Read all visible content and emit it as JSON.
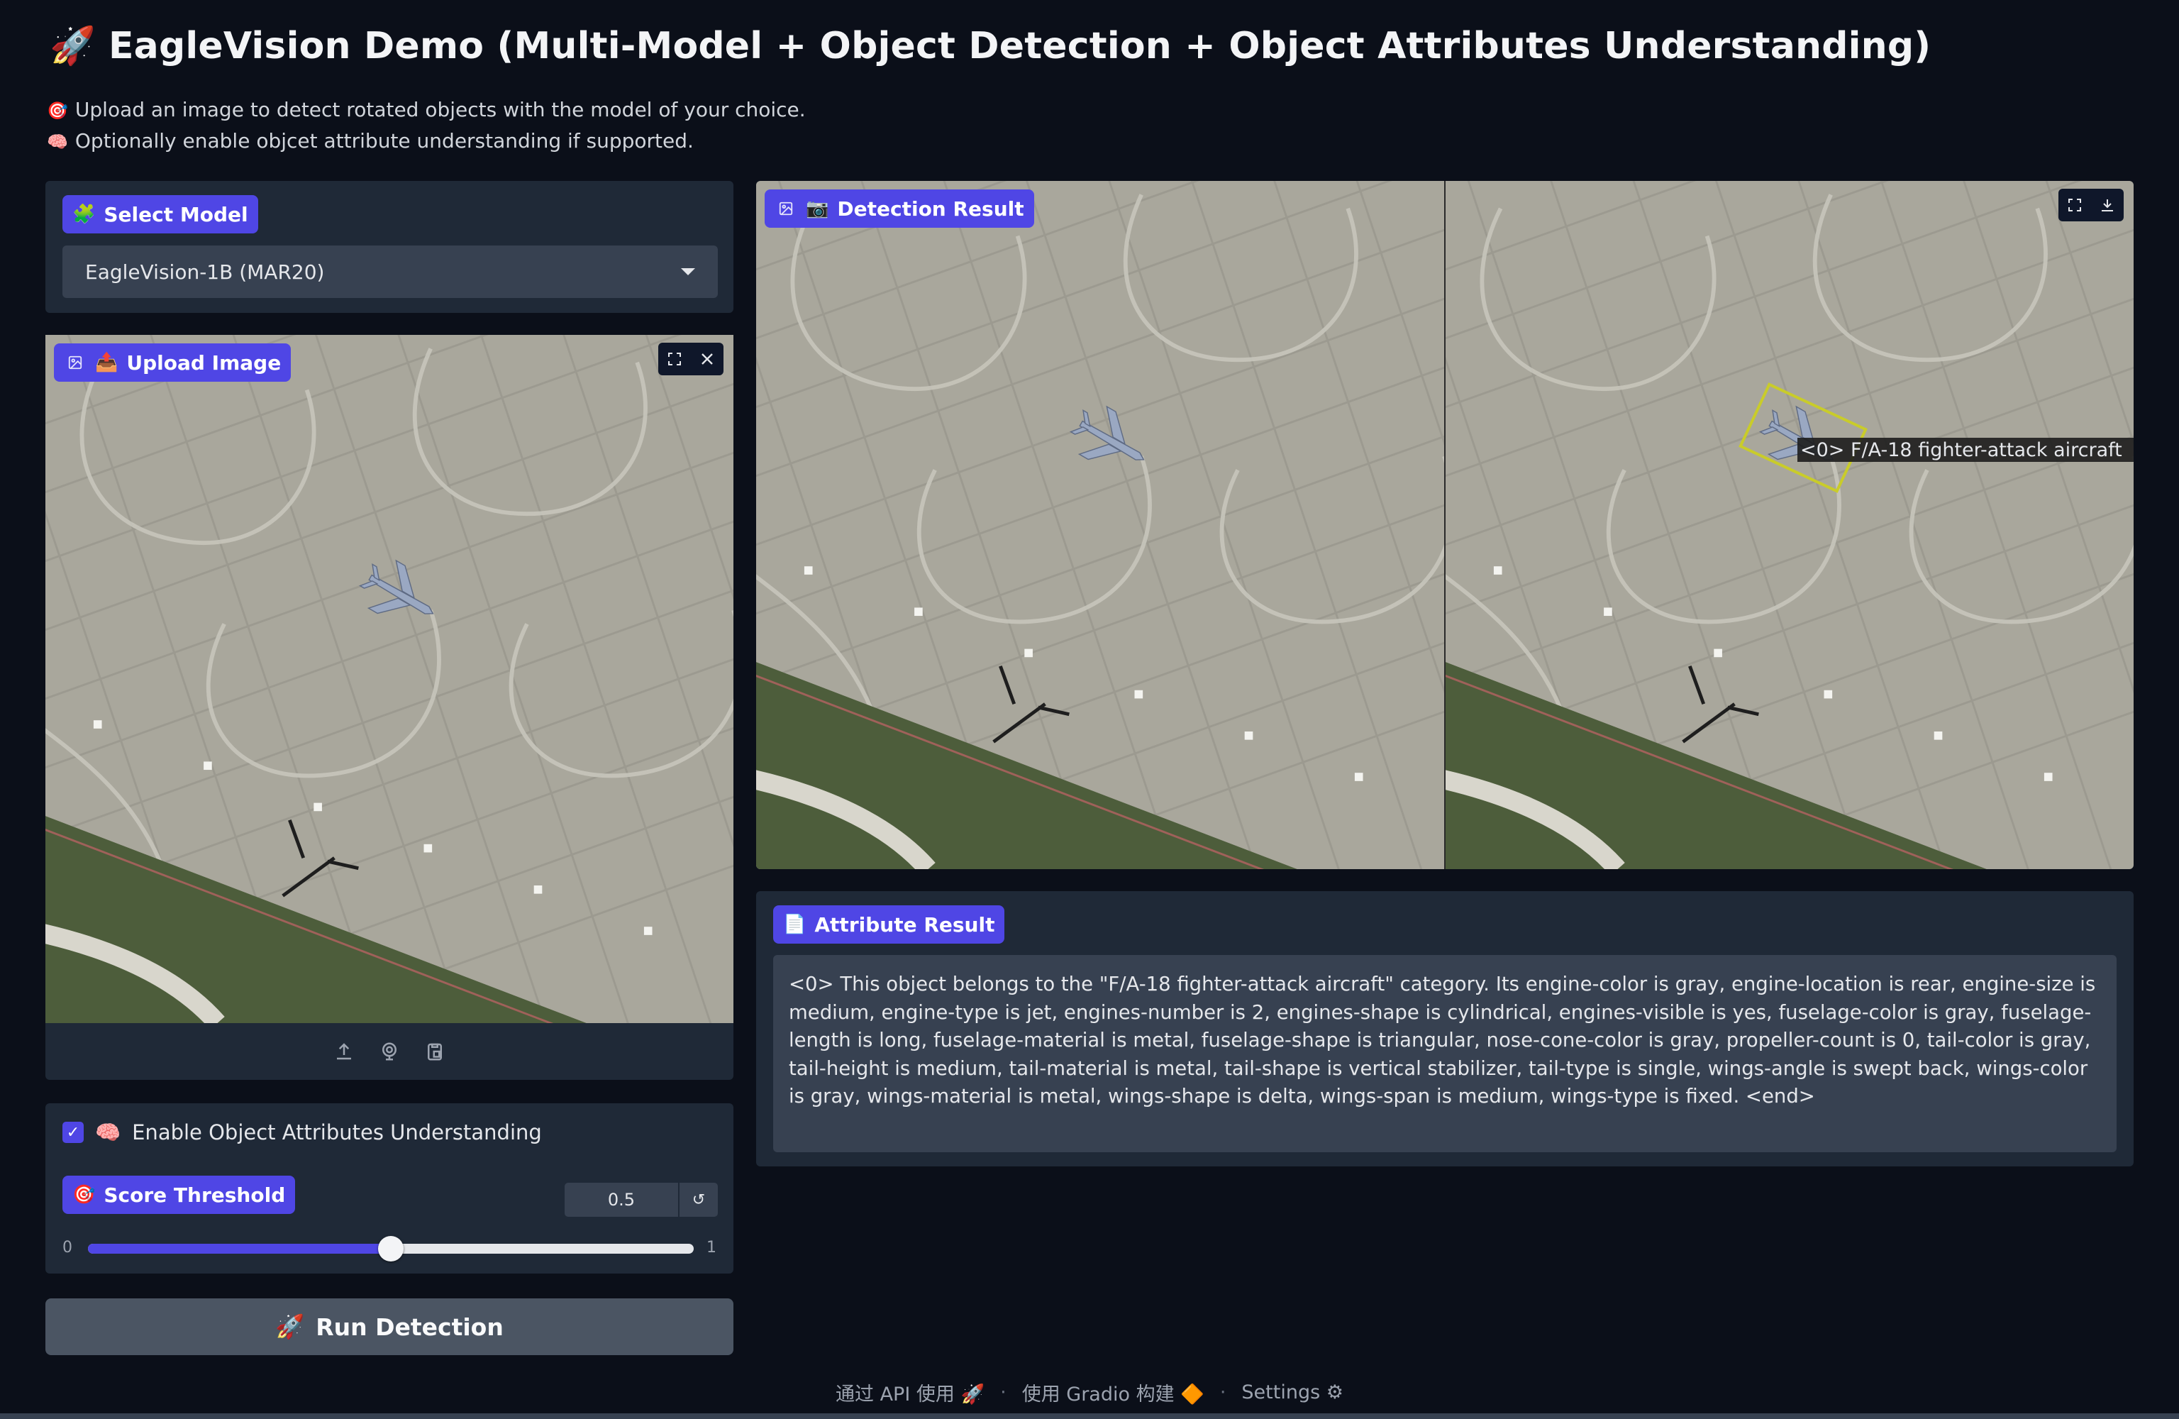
{
  "header": {
    "title": "EagleVision Demo (Multi-Model + Object Detection + Object Attributes Understanding)",
    "title_icon": "rocket-icon",
    "desc_lines": [
      {
        "icon": "target-icon",
        "emoji": "🎯",
        "text": "Upload an image to detect rotated objects with the model of your choice."
      },
      {
        "icon": "brain-icon",
        "emoji": "🧠",
        "text": "Optionally enable objcet attribute understanding if supported."
      }
    ]
  },
  "model": {
    "label": "Select Model",
    "label_emoji": "🧩",
    "selected": "EagleVision-1B (MAR20)"
  },
  "upload": {
    "label": "Upload Image",
    "label_emoji": "📤"
  },
  "options": {
    "attr_label": "Enable Object Attributes Understanding",
    "attr_emoji": "🧠",
    "attr_checked": true,
    "threshold_label": "Score Threshold",
    "threshold_emoji": "🎯",
    "threshold_value": "0.5",
    "slider_min": "0",
    "slider_max": "1",
    "slider_fraction": 0.5
  },
  "run_button": {
    "label": "Run Detection",
    "emoji": "🚀"
  },
  "detection": {
    "label": "Detection Result",
    "label_emoji": "📷",
    "box_label": "<0> F/A-18 fighter-attack aircraft"
  },
  "attributes": {
    "label": "Attribute Result",
    "label_emoji": "📄",
    "text": "<0> This object belongs to the \"F/A-18 fighter-attack aircraft\" category. Its engine-color is gray, engine-location is rear, engine-size is medium, engine-type is jet, engines-number is 2, engines-shape is cylindrical, engines-visible is yes, fuselage-color is gray, fuselage-length is long, fuselage-material is metal, fuselage-shape is triangular, nose-cone-color is gray, propeller-count is 0, tail-color is gray, tail-height is medium, tail-material is metal, tail-shape is vertical stabilizer, tail-type is single, wings-angle is swept back, wings-color is gray, wings-material is metal, wings-shape is delta, wings-span is medium, wings-type is fixed. <end>"
  },
  "footer": {
    "api": "通过 API 使用",
    "api_emoji": "🚀",
    "built": "使用 Gradio 构建",
    "built_emoji": "🔶",
    "settings": "Settings",
    "settings_emoji": "⚙"
  },
  "colors": {
    "background": "#0b0f19",
    "panel": "#1f2937",
    "input": "#374151",
    "accent": "#4f46e5",
    "box": "#c9cc2a"
  }
}
